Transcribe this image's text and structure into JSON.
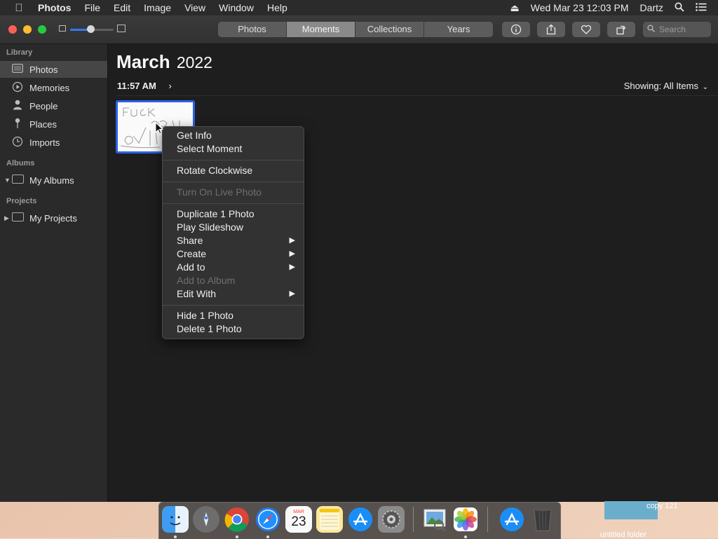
{
  "menubar": {
    "app": "Photos",
    "items": [
      "File",
      "Edit",
      "Image",
      "View",
      "Window",
      "Help"
    ],
    "datetime": "Wed Mar 23  12:03 PM",
    "user": "Dartz"
  },
  "toolbar": {
    "tabs": [
      "Photos",
      "Moments",
      "Collections",
      "Years"
    ],
    "selected_tab": "Moments",
    "search_placeholder": "Search"
  },
  "sidebar": {
    "library_header": "Library",
    "library": [
      {
        "label": "Photos",
        "icon": "photos-icon"
      },
      {
        "label": "Memories",
        "icon": "memories-icon"
      },
      {
        "label": "People",
        "icon": "people-icon"
      },
      {
        "label": "Places",
        "icon": "places-icon"
      },
      {
        "label": "Imports",
        "icon": "imports-icon"
      }
    ],
    "albums_header": "Albums",
    "albums_item": "My Albums",
    "projects_header": "Projects",
    "projects_item": "My Projects"
  },
  "main": {
    "month": "March",
    "year": "2022",
    "moment_time": "11:57 AM",
    "showing": "Showing: All Items"
  },
  "context_menu": {
    "items": [
      {
        "label": "Get Info",
        "enabled": true
      },
      {
        "label": "Select Moment",
        "enabled": true
      },
      {
        "label": "Rotate Clockwise",
        "enabled": true
      },
      {
        "label": "Turn On Live Photo",
        "enabled": false
      },
      {
        "label": "Duplicate 1 Photo",
        "enabled": true
      },
      {
        "label": "Play Slideshow",
        "enabled": true
      },
      {
        "label": "Share",
        "enabled": true,
        "submenu": true
      },
      {
        "label": "Create",
        "enabled": true,
        "submenu": true
      },
      {
        "label": "Add to",
        "enabled": true,
        "submenu": true
      },
      {
        "label": "Add to Album",
        "enabled": false
      },
      {
        "label": "Edit With",
        "enabled": true,
        "submenu": true
      },
      {
        "label": "Hide 1 Photo",
        "enabled": true
      },
      {
        "label": "Delete 1 Photo",
        "enabled": true
      }
    ]
  },
  "dock": {
    "calendar_month": "MAR",
    "calendar_day": "23",
    "apps": [
      "Finder",
      "Launchpad",
      "Chrome",
      "Safari",
      "Calendar",
      "Notes",
      "App Store",
      "System Preferences",
      "Preview",
      "Photos",
      "App Store Downloads",
      "Trash"
    ]
  },
  "desktop": {
    "item_label": "copy 121",
    "item_label2": "untitled folder"
  },
  "colors": {
    "accent": "#2a62e8",
    "selected_tab": "#8a8a8a"
  }
}
